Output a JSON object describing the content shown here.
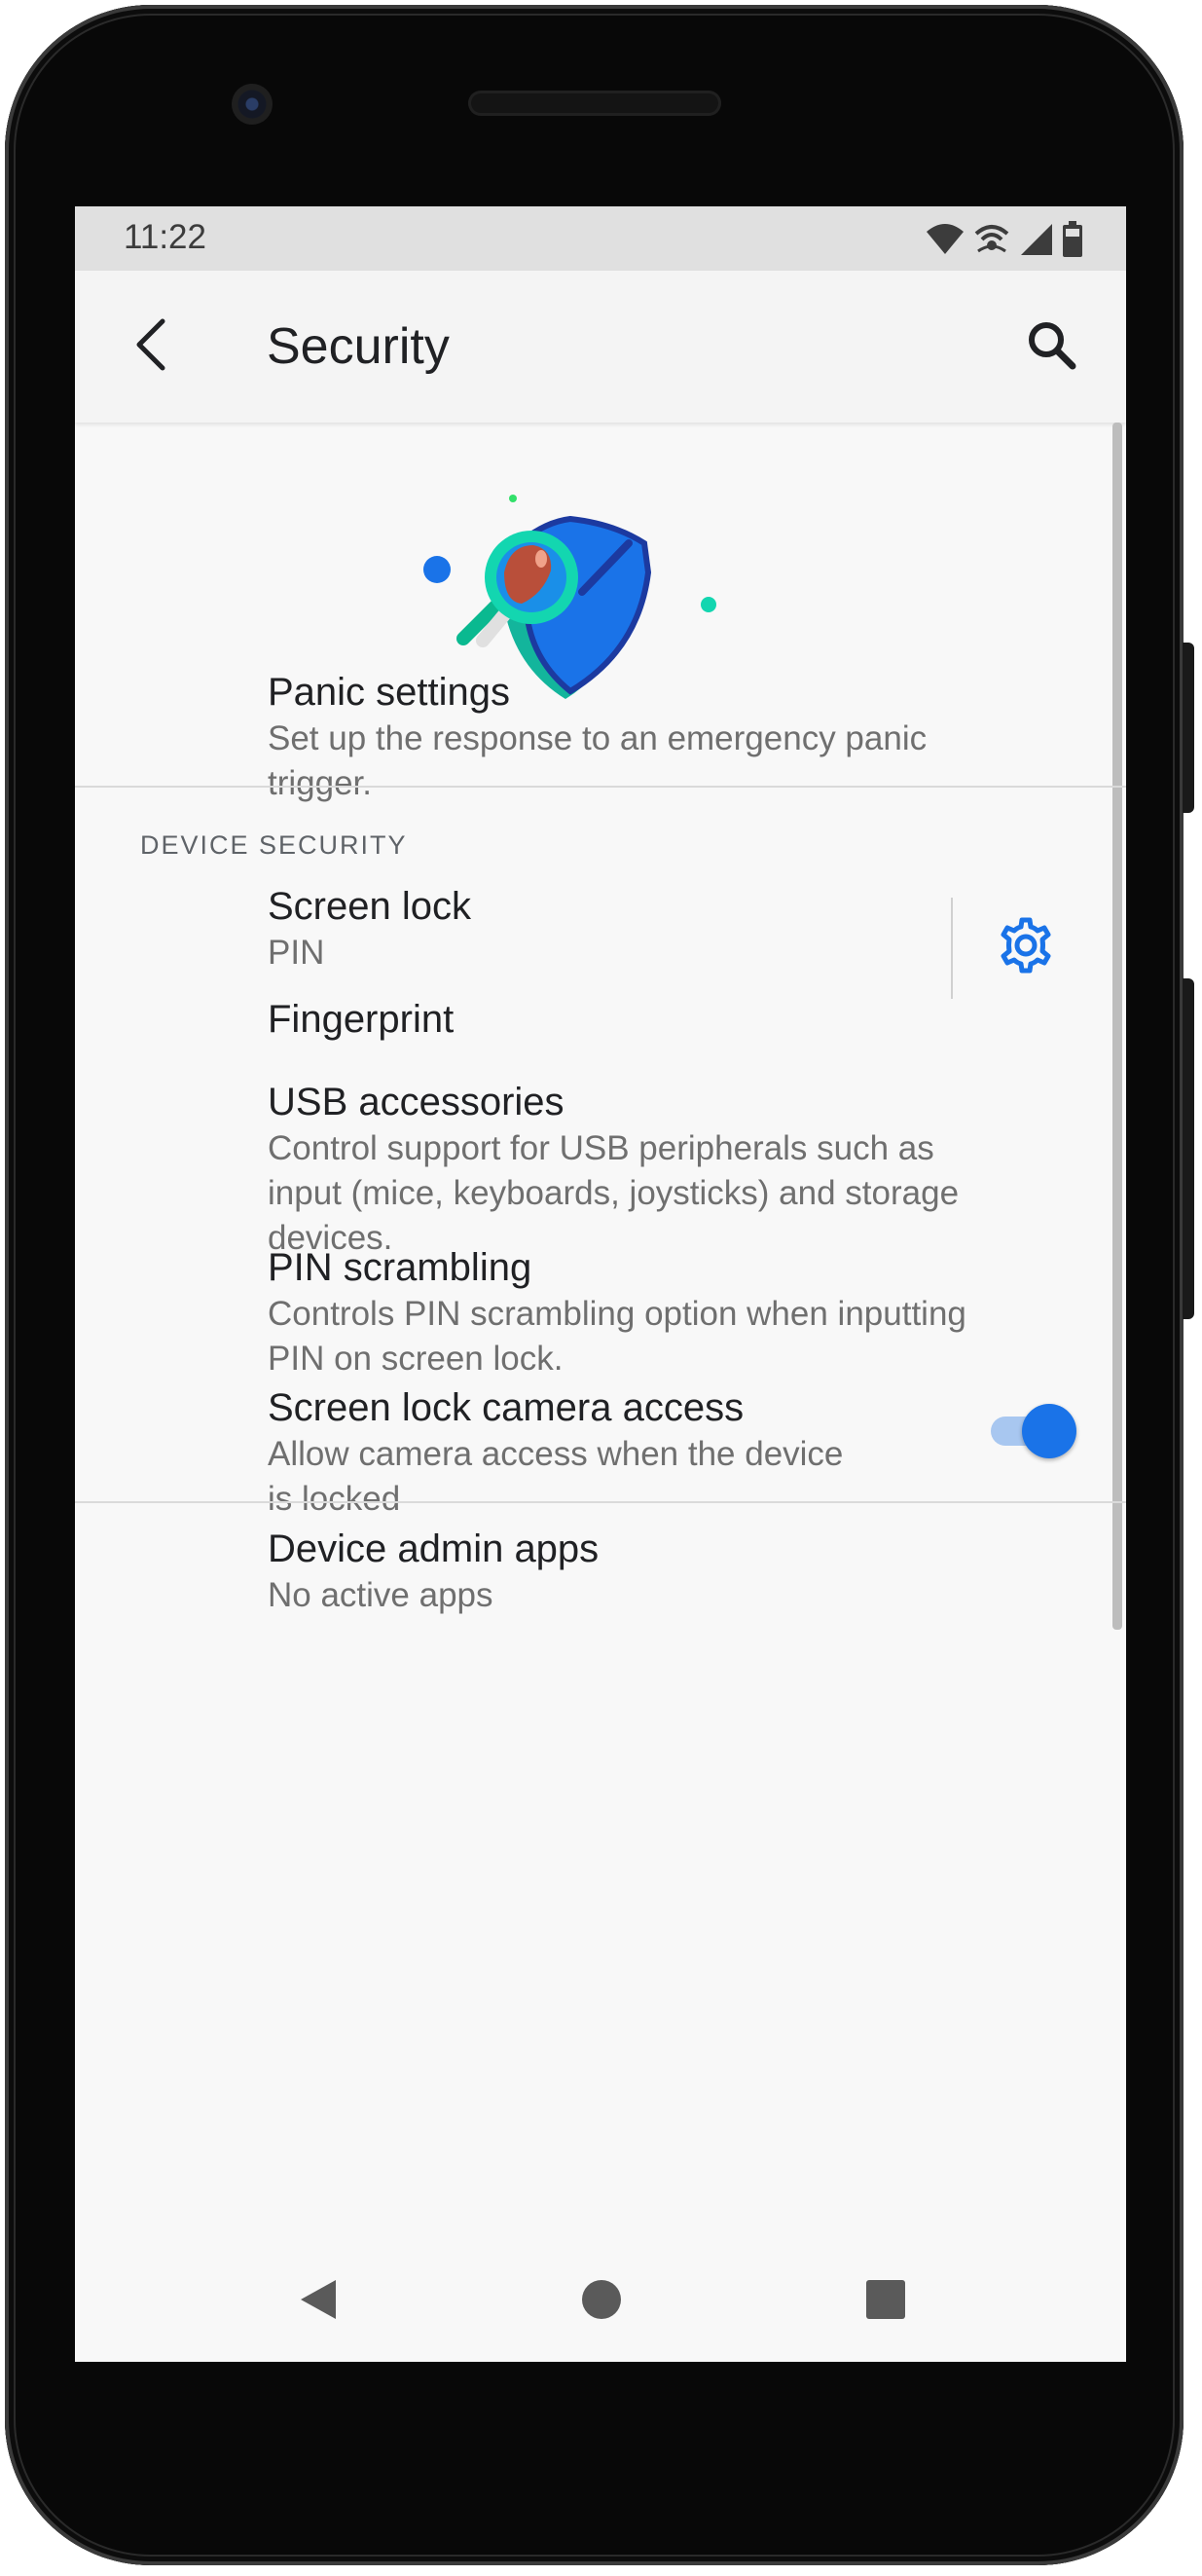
{
  "status_bar": {
    "time": "11:22",
    "icons": [
      "wifi-icon",
      "hotspot-icon",
      "cellular-signal-icon",
      "battery-icon"
    ]
  },
  "app_bar": {
    "title": "Security",
    "back_icon": "arrow-back-icon",
    "search_icon": "search-icon"
  },
  "header_illustration": "security-shield-magnifier-illustration",
  "panic_settings": {
    "title": "Panic settings",
    "subtitle_line1": "Set up the response to an emergency panic",
    "subtitle_line2": "trigger."
  },
  "section_device_security": "DEVICE SECURITY",
  "screen_lock": {
    "title": "Screen lock",
    "subtitle": "PIN",
    "settings_icon": "gear-icon"
  },
  "fingerprint": {
    "title": "Fingerprint"
  },
  "usb_accessories": {
    "title": "USB accessories",
    "subtitle_line1": "Control support for USB peripherals such as",
    "subtitle_line2": "input (mice, keyboards, joysticks) and storage",
    "subtitle_line3": "devices."
  },
  "pin_scrambling": {
    "title": "PIN scrambling",
    "subtitle_line1": "Controls PIN scrambling option when inputting",
    "subtitle_line2": "PIN on screen lock."
  },
  "screen_lock_camera_access": {
    "title": "Screen lock camera access",
    "subtitle_line1": "Allow camera access when the device",
    "subtitle_line2": "is locked",
    "toggle_on": true
  },
  "device_admin_apps": {
    "title": "Device admin apps",
    "subtitle": "No active apps"
  },
  "nav_bar": {
    "buttons": [
      "back-triangle-icon",
      "home-circle-icon",
      "recents-square-icon"
    ]
  },
  "colors": {
    "accent": "#1a73e8",
    "toggle_track": "#a8c7f0",
    "status_bar": "#e0e0e0",
    "background": "#f8f8f8"
  }
}
